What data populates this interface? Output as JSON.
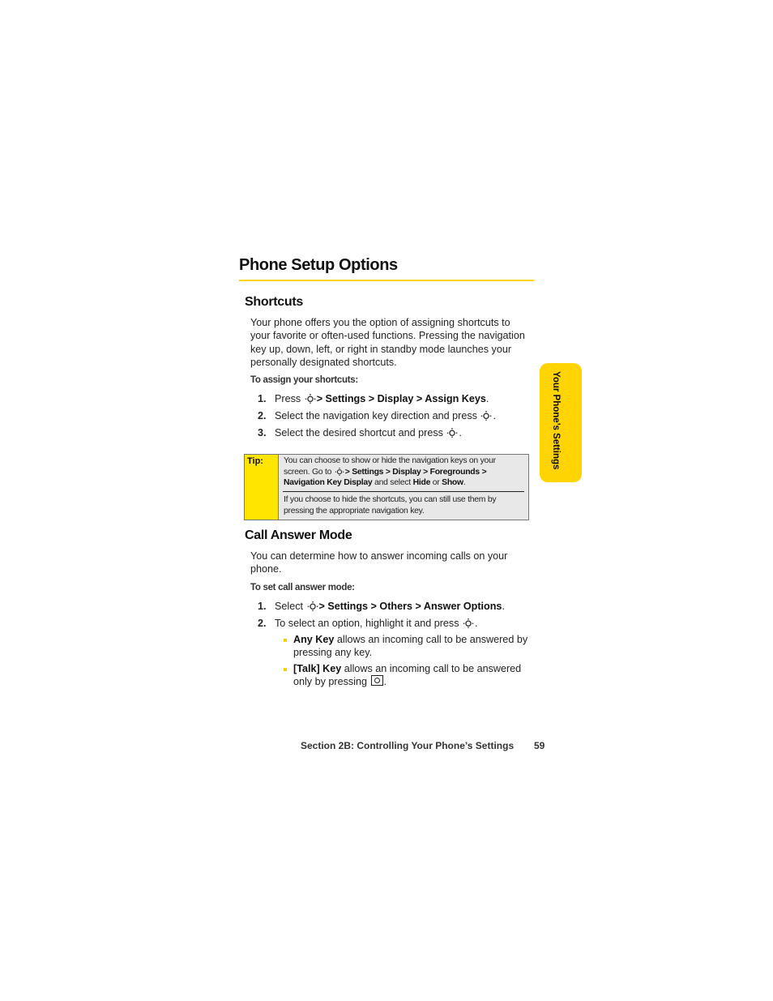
{
  "page": {
    "title": "Phone Setup Options",
    "side_tab": "Your Phone’s Settings",
    "accent_color": "#ffd400"
  },
  "shortcuts": {
    "heading": "Shortcuts",
    "intro_lines": [
      "Your phone offers you the option of assigning shortcuts to",
      "your favorite or often-used functions. Pressing the navigation",
      "key up, down, left, or right in standby mode launches your",
      "personally designated shortcuts."
    ],
    "procedure_label": "To assign your shortcuts:",
    "steps": [
      {
        "num": "1.",
        "pre": "Press",
        "path": "> Settings > Display > Assign Keys",
        "post": "."
      },
      {
        "num": "2.",
        "pre": "Select the navigation key direction and press",
        "post": "."
      },
      {
        "num": "3.",
        "pre": "Select the desired shortcut and press",
        "post": "."
      }
    ],
    "icons": {
      "nav_key": "nav-key-icon"
    }
  },
  "tip": {
    "label": "Tip:",
    "p1_line1": "You can choose to show or hide the navigation keys on your",
    "p1_line2_pre": "screen. Go to",
    "p1_line2_path": "> Settings > Display > Foregrounds >",
    "p1_line3_bold1": "Navigation Key Display",
    "p1_line3_mid": "and select",
    "p1_line3_bold2": "Hide",
    "p1_line3_or": "or",
    "p1_line3_bold3": "Show",
    "p1_line3_end": ".",
    "p2_line1": "If you choose to hide the shortcuts, you can still use them by",
    "p2_line2": "pressing the appropriate navigation key."
  },
  "call_answer": {
    "heading": "Call Answer Mode",
    "intro_lines": [
      "You can determine how to answer incoming calls on your",
      "phone."
    ],
    "procedure_label": "To set call answer mode:",
    "steps": [
      {
        "num": "1.",
        "pre": "Select",
        "path": "> Settings > Others > Answer Options",
        "post": "."
      },
      {
        "num": "2.",
        "pre": "To select an option, highlight it and press",
        "post": "."
      }
    ],
    "options": [
      {
        "name": "Any Key",
        "line1": "allows an incoming call to be answered by",
        "line2": "pressing any key."
      },
      {
        "name": "[Talk] Key",
        "line1": "allows an incoming call to be answered",
        "line2": "only by pressing",
        "line2_end": "."
      }
    ]
  },
  "footer": {
    "section": "Section 2B: Controlling Your Phone’s Settings",
    "page_number": "59"
  }
}
